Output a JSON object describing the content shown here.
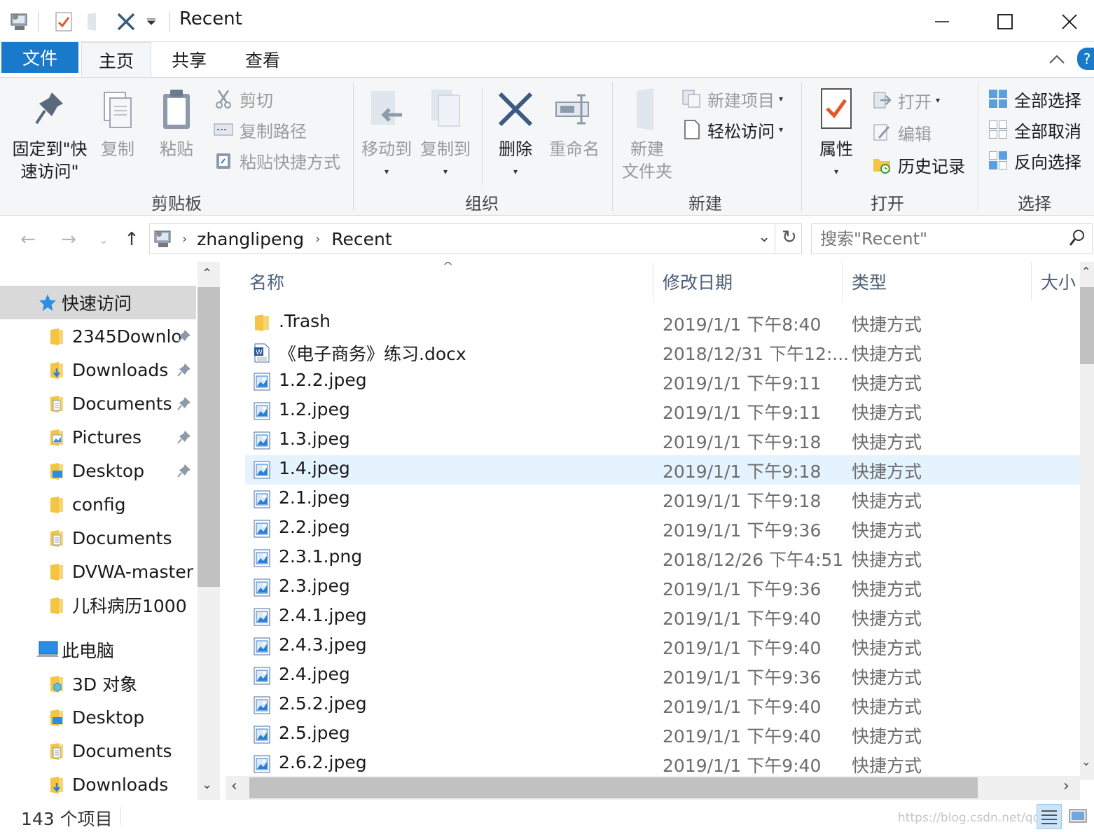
{
  "window": {
    "title": "Recent",
    "minimize_icon": "minimize-icon",
    "maximize_icon": "maximize-icon",
    "close_icon": "close-icon"
  },
  "ribbon_tabs": {
    "file": "文件",
    "home": "主页",
    "share": "共享",
    "view": "查看"
  },
  "ribbon": {
    "clipboard": {
      "group_label": "剪贴板",
      "pin_label_line1": "固定到\"快",
      "pin_label_line2": "速访问\"",
      "copy": "复制",
      "paste": "粘贴",
      "cut": "剪切",
      "copy_path": "复制路径",
      "paste_shortcut": "粘贴快捷方式"
    },
    "organize": {
      "group_label": "组织",
      "move_to": "移动到",
      "copy_to": "复制到",
      "delete": "删除",
      "rename": "重命名"
    },
    "new": {
      "group_label": "新建",
      "new_folder_line1": "新建",
      "new_folder_line2": "文件夹",
      "new_item": "新建项目",
      "easy_access": "轻松访问"
    },
    "open": {
      "group_label": "打开",
      "properties": "属性",
      "open": "打开",
      "edit": "编辑",
      "history": "历史记录"
    },
    "select": {
      "group_label": "选择",
      "select_all": "全部选择",
      "select_none": "全部取消",
      "invert": "反向选择"
    }
  },
  "address": {
    "crumbs": [
      "zhanglipeng",
      "Recent"
    ],
    "search_placeholder": "搜索\"Recent\""
  },
  "nav_pane": {
    "quick_access": "快速访问",
    "quick_items": [
      {
        "label": "2345Downlo",
        "pinned": true
      },
      {
        "label": "Downloads",
        "pinned": true
      },
      {
        "label": "Documents",
        "pinned": true
      },
      {
        "label": "Pictures",
        "pinned": true
      },
      {
        "label": "Desktop",
        "pinned": true
      },
      {
        "label": "config",
        "pinned": false
      },
      {
        "label": "Documents",
        "pinned": false
      },
      {
        "label": "DVWA-master",
        "pinned": false
      },
      {
        "label": "儿科病历1000",
        "pinned": false
      }
    ],
    "this_pc": "此电脑",
    "pc_items": [
      "3D 对象",
      "Desktop",
      "Documents",
      "Downloads"
    ]
  },
  "columns": {
    "name": "名称",
    "date": "修改日期",
    "type": "类型",
    "size": "大小"
  },
  "files": [
    {
      "name": ".Trash",
      "date": "2019/1/1 下午8:40",
      "type": "快捷方式",
      "icon": "folder-icon"
    },
    {
      "name": "《电子商务》练习.docx",
      "date": "2018/12/31 下午12:...",
      "type": "快捷方式",
      "icon": "word-doc-icon"
    },
    {
      "name": "1.2.2.jpeg",
      "date": "2019/1/1 下午9:11",
      "type": "快捷方式",
      "icon": "image-icon"
    },
    {
      "name": "1.2.jpeg",
      "date": "2019/1/1 下午9:11",
      "type": "快捷方式",
      "icon": "image-icon"
    },
    {
      "name": "1.3.jpeg",
      "date": "2019/1/1 下午9:18",
      "type": "快捷方式",
      "icon": "image-icon"
    },
    {
      "name": "1.4.jpeg",
      "date": "2019/1/1 下午9:18",
      "type": "快捷方式",
      "icon": "image-icon",
      "selected": true
    },
    {
      "name": "2.1.jpeg",
      "date": "2019/1/1 下午9:18",
      "type": "快捷方式",
      "icon": "image-icon"
    },
    {
      "name": "2.2.jpeg",
      "date": "2019/1/1 下午9:36",
      "type": "快捷方式",
      "icon": "image-icon"
    },
    {
      "name": "2.3.1.png",
      "date": "2018/12/26 下午4:51",
      "type": "快捷方式",
      "icon": "image-icon"
    },
    {
      "name": "2.3.jpeg",
      "date": "2019/1/1 下午9:36",
      "type": "快捷方式",
      "icon": "image-icon"
    },
    {
      "name": "2.4.1.jpeg",
      "date": "2019/1/1 下午9:40",
      "type": "快捷方式",
      "icon": "image-icon"
    },
    {
      "name": "2.4.3.jpeg",
      "date": "2019/1/1 下午9:40",
      "type": "快捷方式",
      "icon": "image-icon"
    },
    {
      "name": "2.4.jpeg",
      "date": "2019/1/1 下午9:36",
      "type": "快捷方式",
      "icon": "image-icon"
    },
    {
      "name": "2.5.2.jpeg",
      "date": "2019/1/1 下午9:40",
      "type": "快捷方式",
      "icon": "image-icon"
    },
    {
      "name": "2.5.jpeg",
      "date": "2019/1/1 下午9:40",
      "type": "快捷方式",
      "icon": "image-icon"
    },
    {
      "name": "2.6.2.jpeg",
      "date": "2019/1/1 下午9:40",
      "type": "快捷方式",
      "icon": "image-icon"
    }
  ],
  "status": {
    "count": "143 个项目",
    "watermark": "https://blog.csdn.net/qq_..."
  },
  "colors": {
    "accent": "#1979ca",
    "selection": "#e5f3ff",
    "folder": "#f4c542",
    "header_text": "#4c607a"
  }
}
